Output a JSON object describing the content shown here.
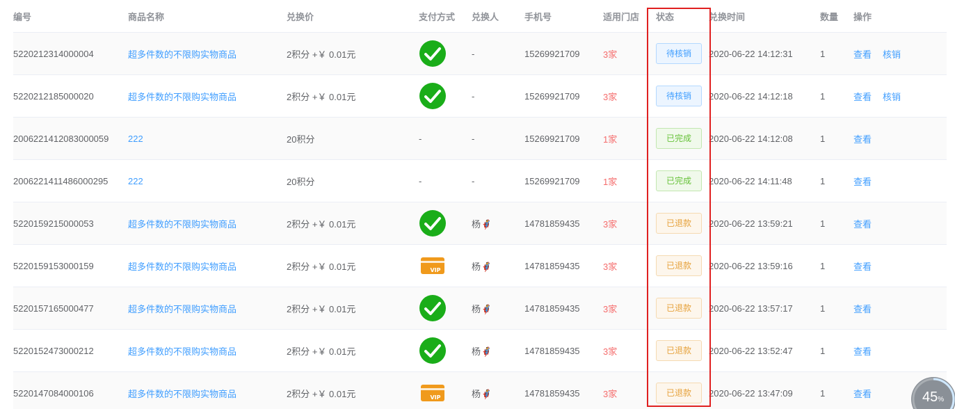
{
  "columns": [
    "编号",
    "商品名称",
    "兑换价",
    "支付方式",
    "兑换人",
    "手机号",
    "适用门店",
    "状态",
    "兑换时间",
    "数量",
    "操作"
  ],
  "rows": [
    {
      "id": "5220212314000004",
      "name": "超多件数的不限购实物商品",
      "price": "2积分 +￥ 0.01元",
      "payment": "wechat-pay-icon",
      "payment_text": "",
      "redeemer": "-",
      "phone": "15269921709",
      "stores": "3家",
      "status": "待核销",
      "status_type": "pending",
      "time": "2020-06-22 14:12:31",
      "qty": "1",
      "actions": [
        "查看",
        "核销"
      ]
    },
    {
      "id": "5220212185000020",
      "name": "超多件数的不限购实物商品",
      "price": "2积分 +￥ 0.01元",
      "payment": "wechat-pay-icon",
      "payment_text": "",
      "redeemer": "-",
      "phone": "15269921709",
      "stores": "3家",
      "status": "待核销",
      "status_type": "pending",
      "time": "2020-06-22 14:12:18",
      "qty": "1",
      "actions": [
        "查看",
        "核销"
      ]
    },
    {
      "id": "2006221412083000059",
      "name": "222",
      "price": "20积分",
      "payment": "none",
      "payment_text": "-",
      "redeemer": "-",
      "phone": "15269921709",
      "stores": "1家",
      "status": "已完成",
      "status_type": "done",
      "time": "2020-06-22 14:12:08",
      "qty": "1",
      "actions": [
        "查看"
      ]
    },
    {
      "id": "2006221411486000295",
      "name": "222",
      "price": "20积分",
      "payment": "none",
      "payment_text": "-",
      "redeemer": "-",
      "phone": "15269921709",
      "stores": "1家",
      "status": "已完成",
      "status_type": "done",
      "time": "2020-06-22 14:11:48",
      "qty": "1",
      "actions": [
        "查看"
      ]
    },
    {
      "id": "5220159215000053",
      "name": "超多件数的不限购实物商品",
      "price": "2积分 +￥ 0.01元",
      "payment": "wechat-pay-icon",
      "payment_text": "",
      "redeemer": "杨🦸",
      "phone": "14781859435",
      "stores": "3家",
      "status": "已退款",
      "status_type": "refund",
      "time": "2020-06-22 13:59:21",
      "qty": "1",
      "actions": [
        "查看"
      ]
    },
    {
      "id": "5220159153000159",
      "name": "超多件数的不限购实物商品",
      "price": "2积分 +￥ 0.01元",
      "payment": "vip-card-icon",
      "payment_text": "",
      "redeemer": "杨🦸",
      "phone": "14781859435",
      "stores": "3家",
      "status": "已退款",
      "status_type": "refund",
      "time": "2020-06-22 13:59:16",
      "qty": "1",
      "actions": [
        "查看"
      ]
    },
    {
      "id": "5220157165000477",
      "name": "超多件数的不限购实物商品",
      "price": "2积分 +￥ 0.01元",
      "payment": "wechat-pay-icon",
      "payment_text": "",
      "redeemer": "杨🦸",
      "phone": "14781859435",
      "stores": "3家",
      "status": "已退款",
      "status_type": "refund",
      "time": "2020-06-22 13:57:17",
      "qty": "1",
      "actions": [
        "查看"
      ]
    },
    {
      "id": "5220152473000212",
      "name": "超多件数的不限购实物商品",
      "price": "2积分 +￥ 0.01元",
      "payment": "wechat-pay-icon",
      "payment_text": "",
      "redeemer": "杨🦸",
      "phone": "14781859435",
      "stores": "3家",
      "status": "已退款",
      "status_type": "refund",
      "time": "2020-06-22 13:52:47",
      "qty": "1",
      "actions": [
        "查看"
      ]
    },
    {
      "id": "5220147084000106",
      "name": "超多件数的不限购实物商品",
      "price": "2积分 +￥ 0.01元",
      "payment": "vip-card-icon",
      "payment_text": "",
      "redeemer": "杨🦸",
      "phone": "14781859435",
      "stores": "3家",
      "status": "已退款",
      "status_type": "refund",
      "time": "2020-06-22 13:47:09",
      "qty": "1",
      "actions": [
        "查看"
      ]
    }
  ],
  "status_styles": {
    "pending": {
      "color": "#409eff",
      "bg": "#ecf5ff",
      "border": "#b3d8ff"
    },
    "done": {
      "color": "#67c23a",
      "bg": "#f0f9eb",
      "border": "#c2e7b0"
    },
    "refund": {
      "color": "#e6a23c",
      "bg": "#fdf6ec",
      "border": "#f5dab1"
    }
  },
  "colors": {
    "wechat_green": "#1aad19",
    "vip_orange": "#f09a1c",
    "highlight_red": "#e02020"
  },
  "progress": {
    "value": "45",
    "unit": "%",
    "fraction": 0.45
  }
}
